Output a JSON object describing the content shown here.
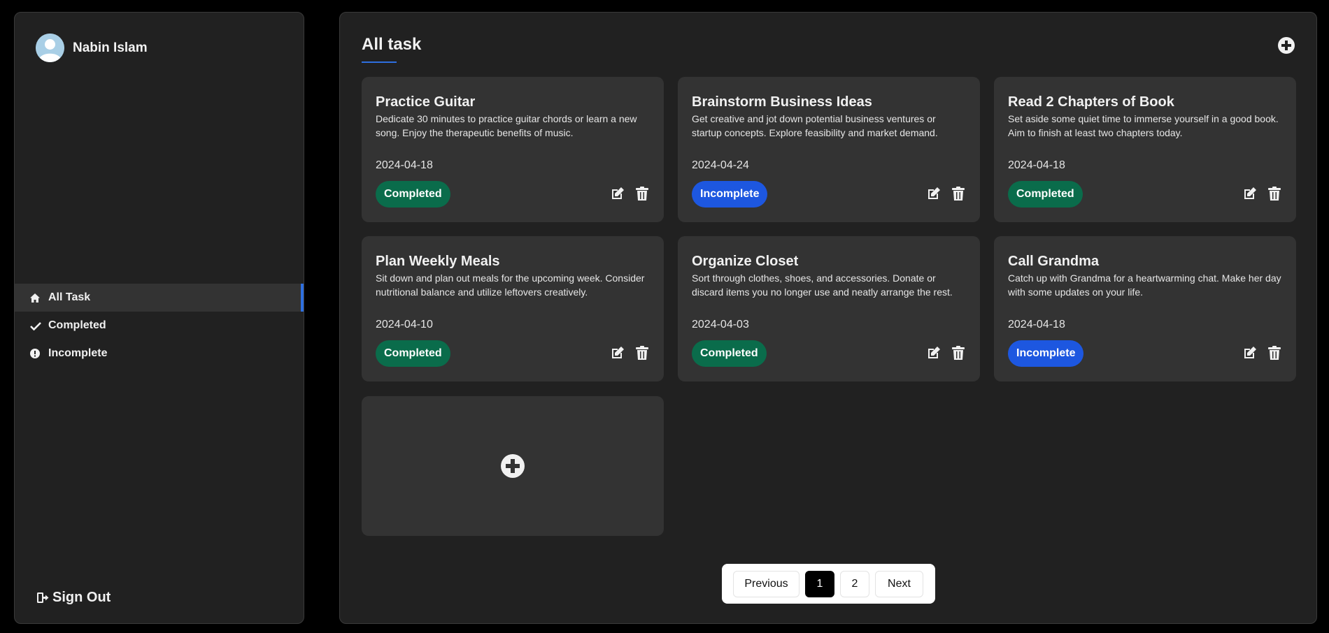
{
  "user": {
    "name": "Nabin Islam"
  },
  "nav": {
    "items": [
      {
        "label": "All Task",
        "icon": "home-icon",
        "active": true
      },
      {
        "label": "Completed",
        "icon": "check-icon",
        "active": false
      },
      {
        "label": "Incomplete",
        "icon": "exclamation-circle-icon",
        "active": false
      }
    ],
    "signout_label": "Sign Out"
  },
  "main": {
    "title": "All task",
    "tasks": [
      {
        "title": "Practice Guitar",
        "description": "Dedicate 30 minutes to practice guitar chords or learn a new song. Enjoy the therapeutic benefits of music.",
        "date": "2024-04-18",
        "status": "Completed"
      },
      {
        "title": "Brainstorm Business Ideas",
        "description": "Get creative and jot down potential business ventures or startup concepts. Explore feasibility and market demand.",
        "date": "2024-04-24",
        "status": "Incomplete"
      },
      {
        "title": "Read 2 Chapters of Book",
        "description": "Set aside some quiet time to immerse yourself in a good book. Aim to finish at least two chapters today.",
        "date": "2024-04-18",
        "status": "Completed"
      },
      {
        "title": "Plan Weekly Meals",
        "description": "Sit down and plan out meals for the upcoming week. Consider nutritional balance and utilize leftovers creatively.",
        "date": "2024-04-10",
        "status": "Completed"
      },
      {
        "title": "Organize Closet",
        "description": "Sort through clothes, shoes, and accessories. Donate or discard items you no longer use and neatly arrange the rest.",
        "date": "2024-04-03",
        "status": "Completed"
      },
      {
        "title": "Call Grandma",
        "description": "Catch up with Grandma for a heartwarming chat. Make her day with some updates on your life.",
        "date": "2024-04-18",
        "status": "Incomplete"
      }
    ]
  },
  "pagination": {
    "previous_label": "Previous",
    "pages": [
      "1",
      "2"
    ],
    "current_page": "1",
    "next_label": "Next"
  },
  "colors": {
    "accent": "#2e6fe0",
    "completed": "#0a6c4b",
    "incomplete": "#1d57e0",
    "card_bg": "#333333",
    "panel_bg": "#212121"
  }
}
